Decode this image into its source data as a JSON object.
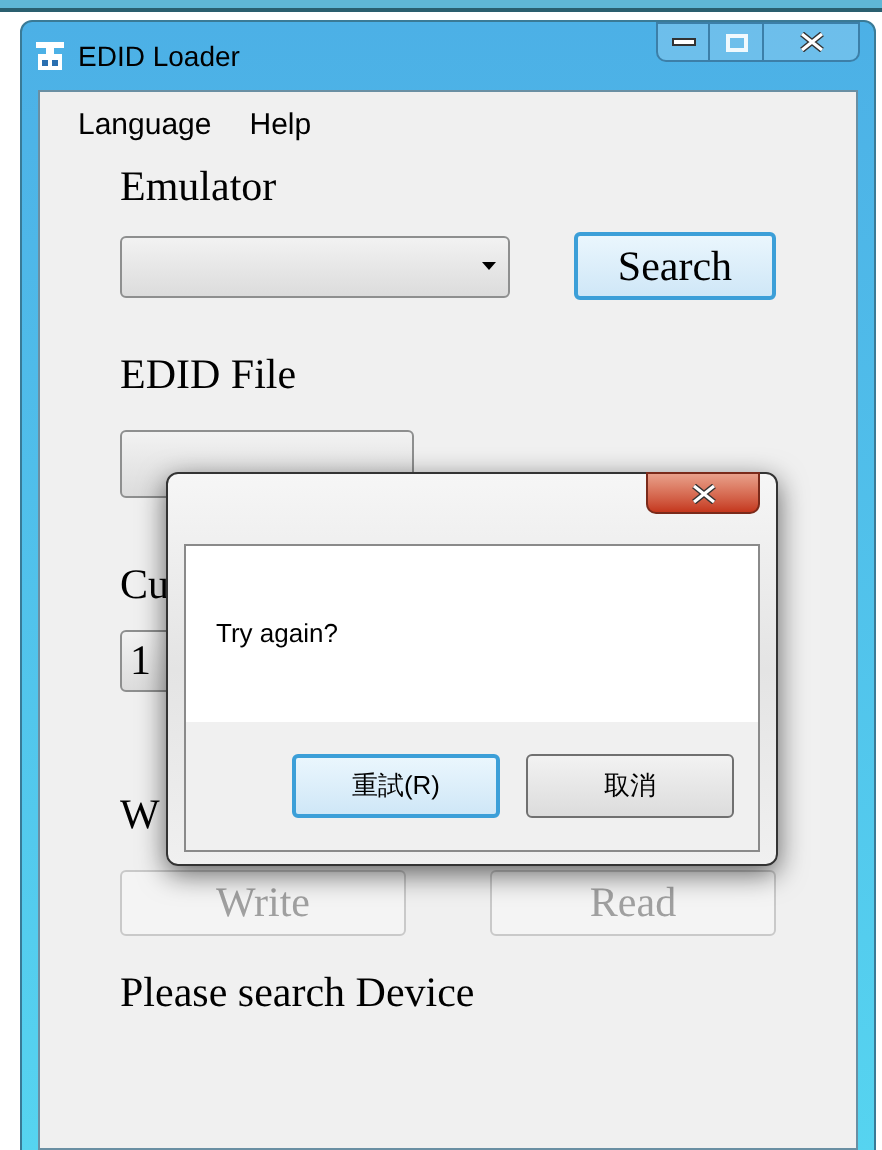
{
  "window": {
    "title": "EDID Loader"
  },
  "menu": [
    {
      "label": "Language"
    },
    {
      "label": "Help"
    }
  ],
  "emulator": {
    "label": "Emulator",
    "search_button": "Search"
  },
  "edid_file": {
    "label": "EDID File"
  },
  "section_3": {
    "label": "Cu",
    "field_value": "1"
  },
  "section_4": {
    "label": "W"
  },
  "actions": [
    {
      "label": "Write",
      "disabled": true
    },
    {
      "label": "Read",
      "disabled": true
    }
  ],
  "status": "Please search Device",
  "dialog": {
    "message": "Try again?",
    "buttons": [
      {
        "label": "重試(R)",
        "default": true
      },
      {
        "label": "取消",
        "default": false
      }
    ]
  }
}
